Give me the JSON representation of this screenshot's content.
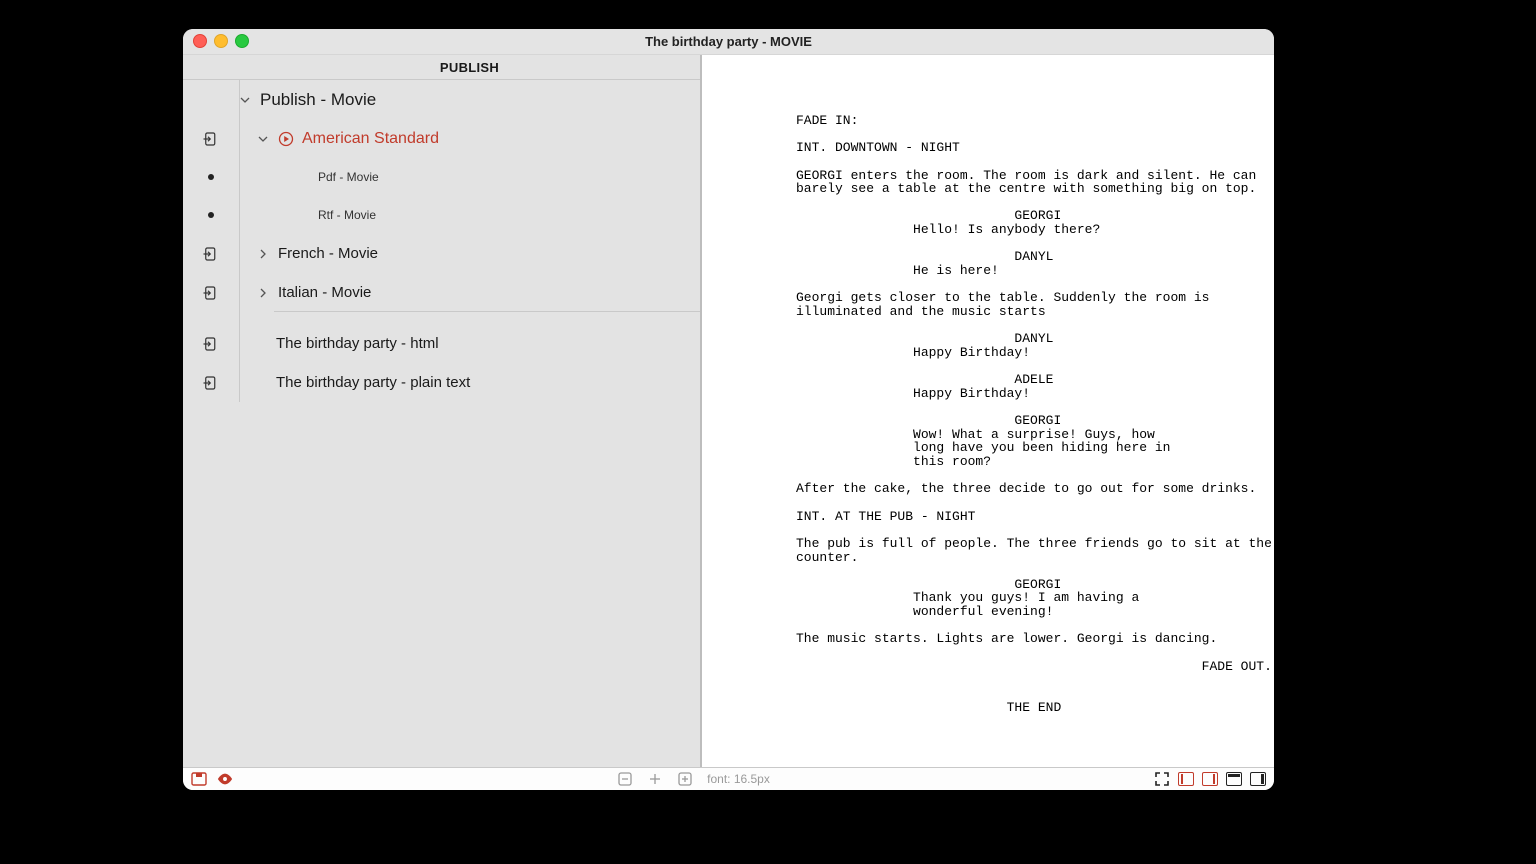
{
  "window": {
    "title": "The birthday party - MOVIE"
  },
  "sidebar": {
    "header": "PUBLISH",
    "root": {
      "label": "Publish - Movie"
    },
    "formats": {
      "american": {
        "label": "American Standard",
        "children": {
          "pdf": "Pdf - Movie",
          "rtf": "Rtf - Movie"
        }
      },
      "french": {
        "label": "French - Movie"
      },
      "italian": {
        "label": "Italian - Movie"
      }
    },
    "extras": {
      "html": "The birthday party - html",
      "plain": "The birthday party - plain text"
    }
  },
  "screenplay": {
    "text": "FADE IN:\n\nINT. DOWNTOWN - NIGHT\n\nGEORGI enters the room. The room is dark and silent. He can\nbarely see a table at the centre with something big on top.\n\n                            GEORGI\n               Hello! Is anybody there?\n\n                            DANYL\n               He is here!\n\nGeorgi gets closer to the table. Suddenly the room is\nilluminated and the music starts\n\n                            DANYL\n               Happy Birthday!\n\n                            ADELE\n               Happy Birthday!\n\n                            GEORGI\n               Wow! What a surprise! Guys, how\n               long have you been hiding here in\n               this room?\n\nAfter the cake, the three decide to go out for some drinks.\n\nINT. AT THE PUB - NIGHT\n\nThe pub is full of people. The three friends go to sit at the\ncounter.\n\n                            GEORGI\n               Thank you guys! I am having a\n               wonderful evening!\n\nThe music starts. Lights are lower. Georgi is dancing.\n\n                                                    FADE OUT.\n\n\n                           THE END"
  },
  "statusbar": {
    "font_label": "font: 16.5px"
  }
}
